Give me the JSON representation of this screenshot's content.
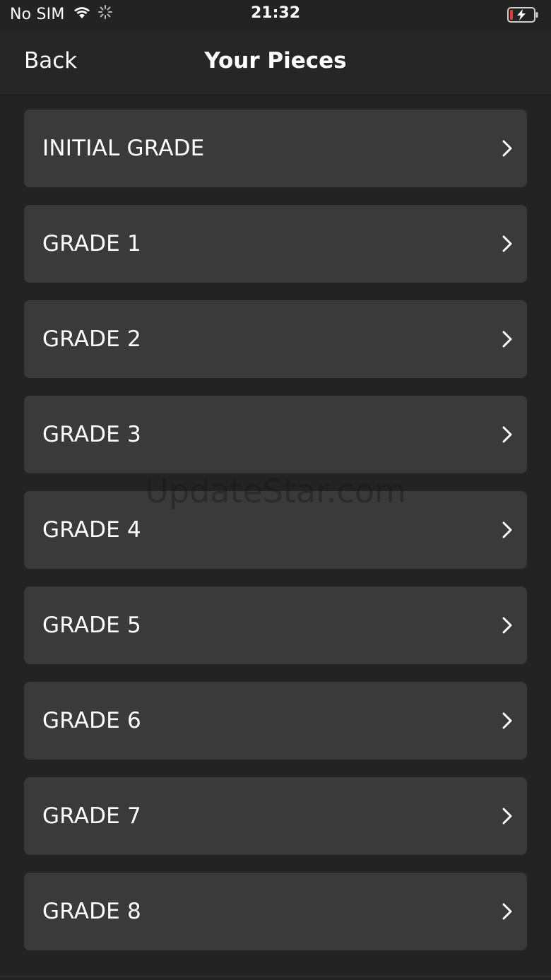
{
  "status_bar": {
    "carrier": "No SIM",
    "time": "21:32",
    "icons": [
      "wifi-icon",
      "activity-spinner-icon",
      "battery-charging-icon"
    ],
    "battery_color": "#e53935"
  },
  "nav": {
    "back_label": "Back",
    "title": "Your Pieces"
  },
  "grades": [
    {
      "label": "INITIAL GRADE"
    },
    {
      "label": "GRADE 1"
    },
    {
      "label": "GRADE 2"
    },
    {
      "label": "GRADE 3"
    },
    {
      "label": "GRADE 4"
    },
    {
      "label": "GRADE 5"
    },
    {
      "label": "GRADE 6"
    },
    {
      "label": "GRADE 7"
    },
    {
      "label": "GRADE 8"
    }
  ],
  "watermark": "UpdateStar.com",
  "colors": {
    "background": "#232323",
    "nav_background": "#262626",
    "row_background": "#3a3a3a",
    "text": "#ffffff"
  }
}
